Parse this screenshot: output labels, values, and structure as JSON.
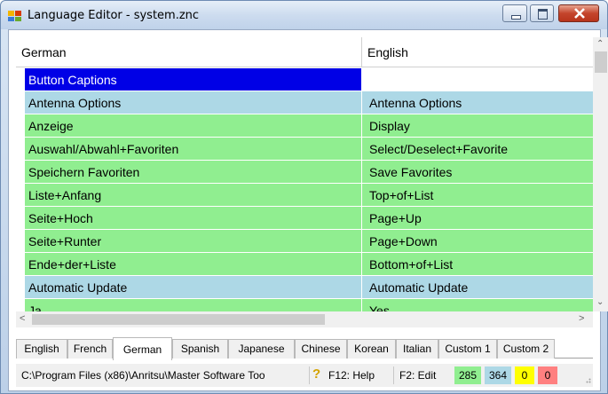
{
  "window": {
    "title": "Language Editor - system.znc"
  },
  "grid": {
    "columns": [
      "German",
      "English"
    ],
    "rows": [
      {
        "de": "Button Captions",
        "en": "",
        "kind": "selected"
      },
      {
        "de": "Antenna Options",
        "en": "Antenna Options",
        "kind": "cat"
      },
      {
        "de": "Anzeige",
        "en": "Display",
        "kind": "item"
      },
      {
        "de": "Auswahl/Abwahl+Favoriten",
        "en": "Select/Deselect+Favorite",
        "kind": "item"
      },
      {
        "de": "Speichern Favoriten",
        "en": "Save Favorites",
        "kind": "item"
      },
      {
        "de": "Liste+Anfang",
        "en": "Top+of+List",
        "kind": "item"
      },
      {
        "de": "Seite+Hoch",
        "en": "Page+Up",
        "kind": "item"
      },
      {
        "de": "Seite+Runter",
        "en": "Page+Down",
        "kind": "item"
      },
      {
        "de": "Ende+der+Liste",
        "en": "Bottom+of+List",
        "kind": "item"
      },
      {
        "de": "Automatic Update",
        "en": "Automatic Update",
        "kind": "cat"
      },
      {
        "de": "Ja",
        "en": "Yes",
        "kind": "item"
      }
    ]
  },
  "tabs": {
    "items": [
      "English",
      "French",
      "German",
      "Spanish",
      "Japanese",
      "Chinese",
      "Korean",
      "Italian",
      "Custom 1",
      "Custom 2"
    ],
    "active": "German"
  },
  "status": {
    "path": "C:\\Program Files (x86)\\Anritsu\\Master Software Too",
    "help": "F12: Help",
    "edit": "F2: Edit",
    "counts": [
      {
        "value": "285",
        "color": "#90ee90"
      },
      {
        "value": "364",
        "color": "#add8e6"
      },
      {
        "value": "0",
        "color": "#ffff00"
      },
      {
        "value": "0",
        "color": "#ff8080"
      }
    ]
  },
  "icons": {
    "app": "app-icon",
    "help": "help-icon"
  }
}
